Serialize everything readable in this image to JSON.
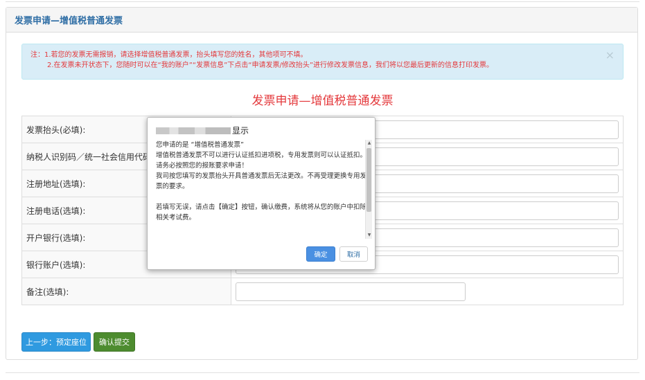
{
  "panel": {
    "title": "发票申请—增值税普通发票"
  },
  "notice": {
    "line1": "注：1.若您的发票无需报销，请选择增值税普通发票，抬头填写您的姓名，其他项可不填。",
    "line2": "2.在发票未开状态下，您随时可以在“我的账户”“发票信息”下点击“申请发票/修改抬头”进行修改发票信息，我们将以您最后更新的信息打印发票。",
    "close_icon": "×"
  },
  "form": {
    "title": "发票申请—增值税普通发票",
    "rows": [
      {
        "label": "发票抬头(必填):",
        "value": ""
      },
      {
        "label": "纳税人识别码／统一社会信用代码",
        "value": ""
      },
      {
        "label": "注册地址(选填):",
        "value": ""
      },
      {
        "label": "注册电话(选填):",
        "value": ""
      },
      {
        "label": "开户银行(选填):",
        "value": ""
      },
      {
        "label": "银行账户(选填):",
        "value": ""
      },
      {
        "label": "备注(选填):",
        "value": ""
      }
    ]
  },
  "buttons": {
    "prev": "上一步：预定座位",
    "submit": "确认提交"
  },
  "dialog": {
    "header_suffix": "显示",
    "body": [
      "您申请的是 “增值税普通发票”",
      "增值税普通发票不可以进行认证抵扣进项税，专用发票则可以认证抵扣。",
      "请务必按照您的报账要求申请！",
      "我司按您填写的发票抬头开具普通发票后无法更改。不再受理更换专用发票的要求。",
      "",
      "若填写无误，请点击【确定】按钮，确认缴费，系统将从您的账户中扣除相关考试费。"
    ],
    "ok": "确定",
    "cancel": "取消"
  }
}
